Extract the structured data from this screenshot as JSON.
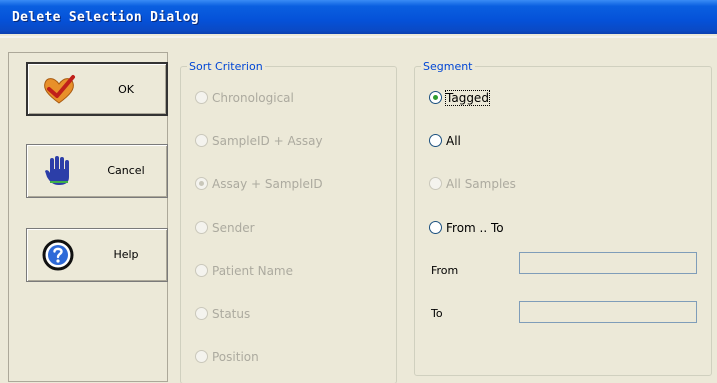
{
  "window": {
    "title": "Delete Selection Dialog"
  },
  "buttons": {
    "ok": {
      "label": "OK",
      "icon": "heart-check-icon"
    },
    "cancel": {
      "label": "Cancel",
      "icon": "stop-hand-icon"
    },
    "help": {
      "label": "Help",
      "icon": "question-icon"
    }
  },
  "sort": {
    "title": "Sort Criterion",
    "enabled": false,
    "options": [
      {
        "label": "Chronological",
        "selected": false
      },
      {
        "label": "SampleID + Assay",
        "selected": false
      },
      {
        "label": "Assay + SampleID",
        "selected": true
      },
      {
        "label": "Sender",
        "selected": false
      },
      {
        "label": "Patient Name",
        "selected": false
      },
      {
        "label": "Status",
        "selected": false
      },
      {
        "label": "Position",
        "selected": false
      }
    ]
  },
  "segment": {
    "title": "Segment",
    "options": [
      {
        "label": "Tagged",
        "selected": true,
        "enabled": true
      },
      {
        "label": "All",
        "selected": false,
        "enabled": true
      },
      {
        "label": "All Samples",
        "selected": false,
        "enabled": false
      },
      {
        "label": "From .. To",
        "selected": false,
        "enabled": true
      }
    ],
    "from_label": "From",
    "from_value": "",
    "to_label": "To",
    "to_value": ""
  },
  "colors": {
    "title_bar": "#0551d8",
    "group_caption": "#0046d5",
    "disabled_text": "#acaa9f",
    "dialog_bg": "#ece9d8"
  }
}
